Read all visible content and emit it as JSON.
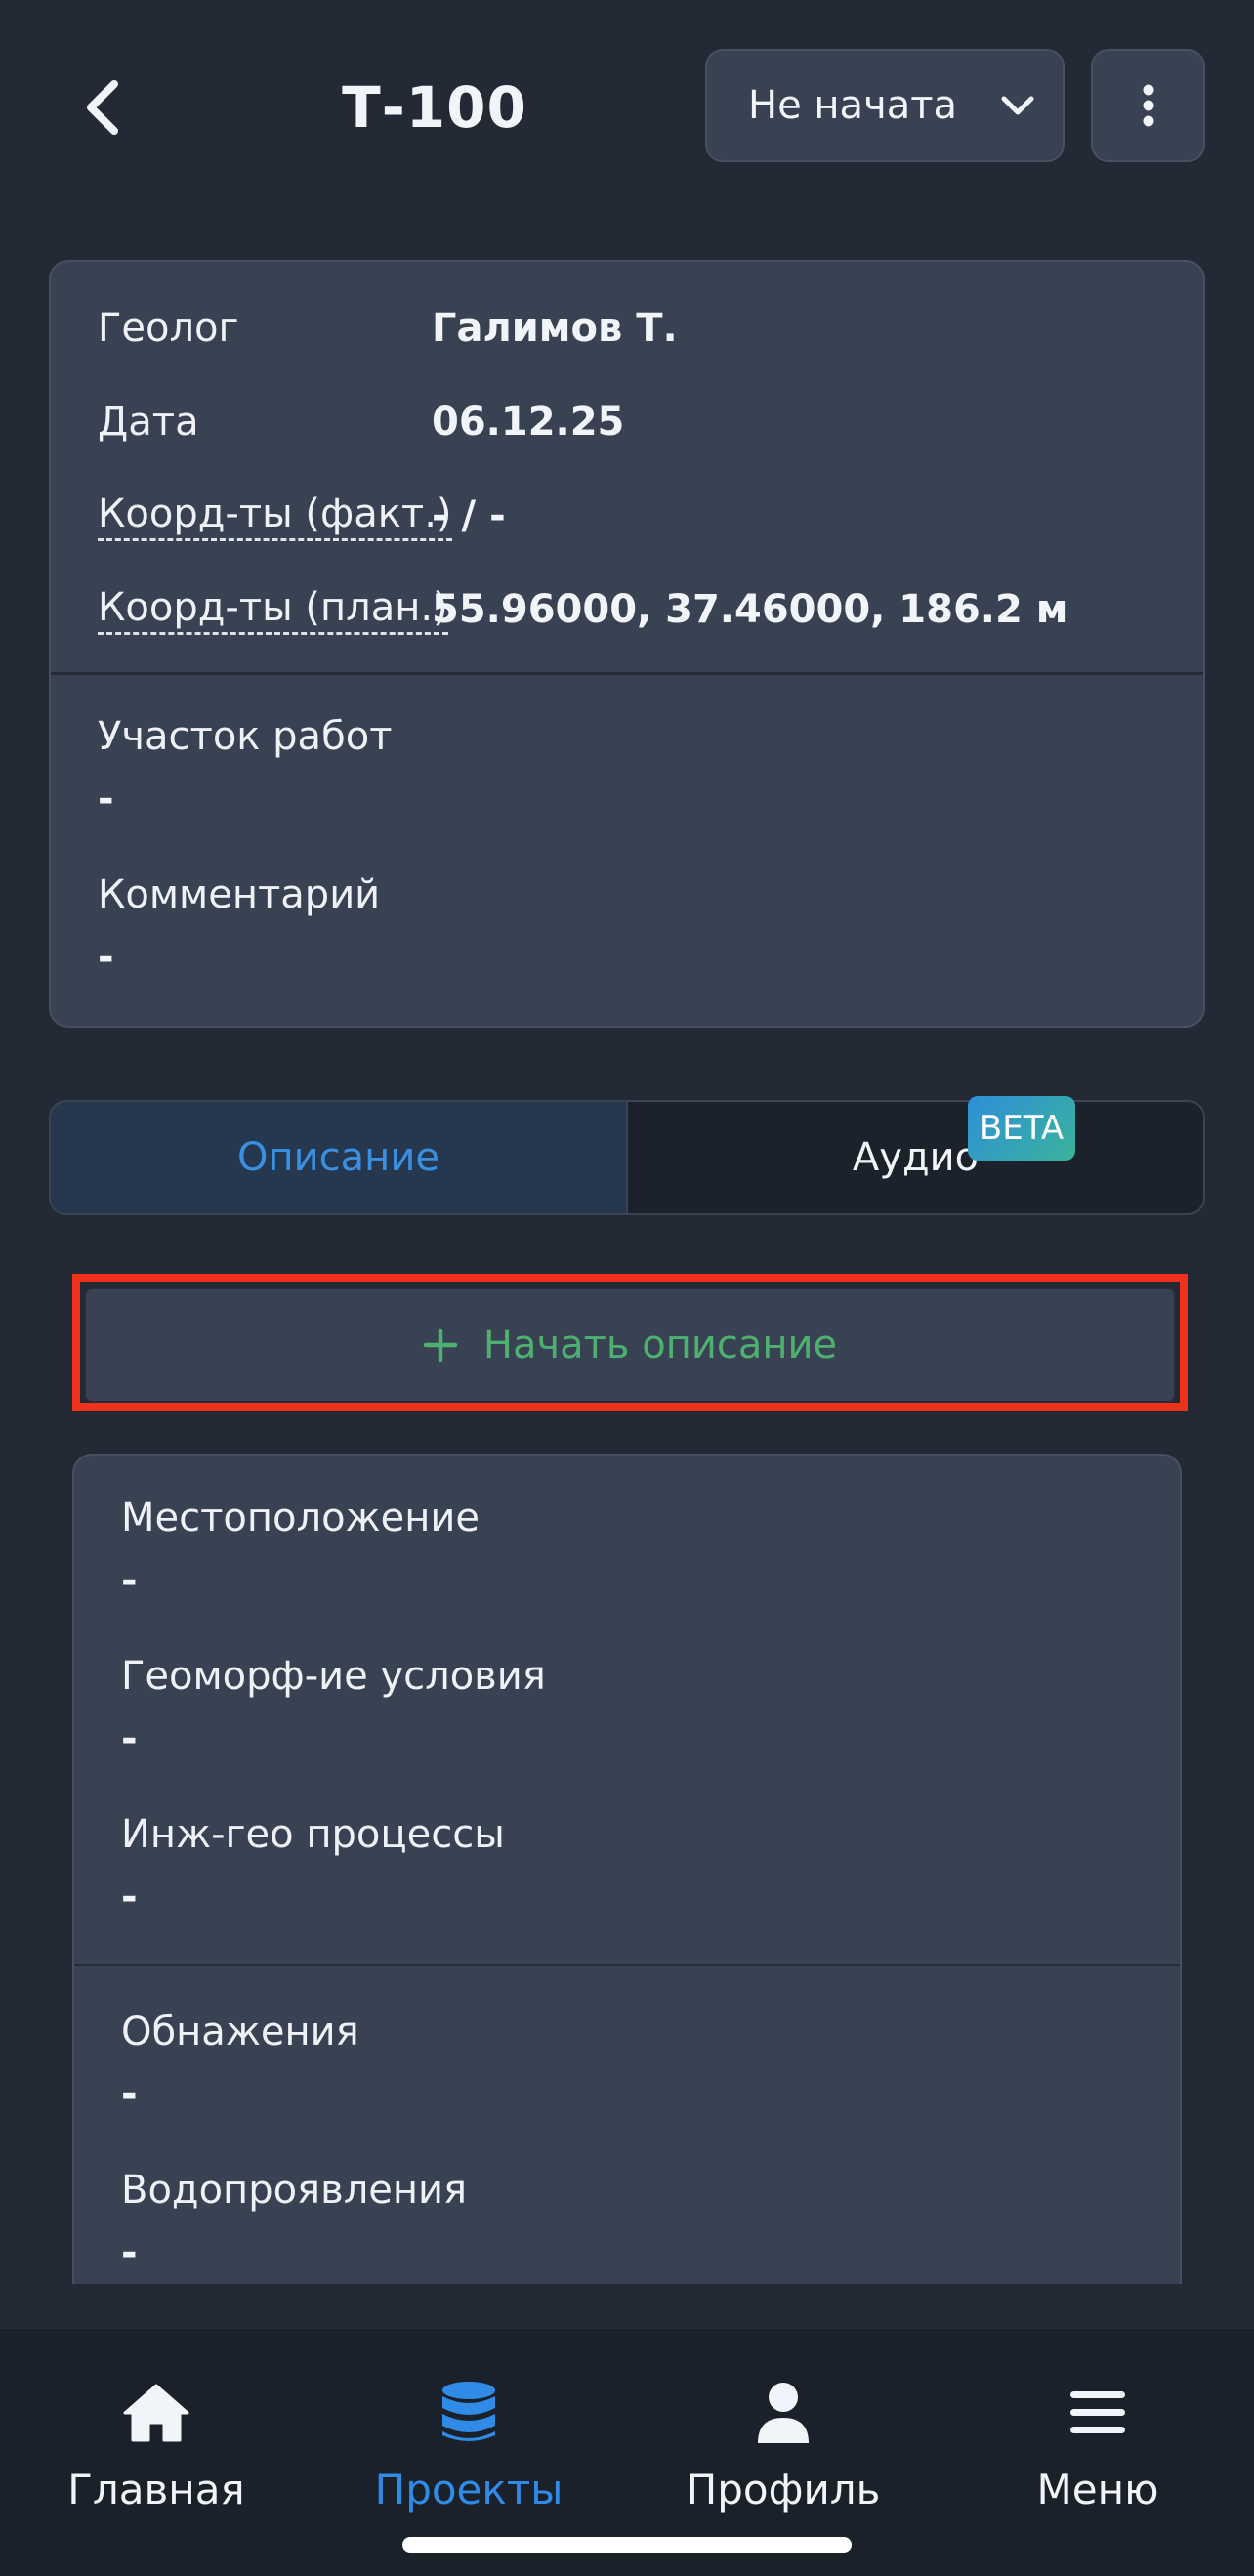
{
  "header": {
    "title": "Т-100",
    "status": "Не начата"
  },
  "info": {
    "rows": [
      {
        "label": "Геолог",
        "value": "Галимов Т."
      },
      {
        "label": "Дата",
        "value": "06.12.25"
      },
      {
        "label": "Коорд-ты (факт.)",
        "value": "- / -"
      },
      {
        "label": "Коорд-ты (план.)",
        "value": "55.96000, 37.46000, 186.2 м"
      }
    ],
    "work_area": {
      "label": "Участок работ",
      "value": "-"
    },
    "comment": {
      "label": "Комментарий",
      "value": "-"
    }
  },
  "tabs": {
    "description": "Описание",
    "audio": "Аудио",
    "badge": "BETA"
  },
  "start_button": "Начать описание",
  "description": {
    "fields": [
      {
        "label": "Местоположение",
        "value": "-"
      },
      {
        "label": "Геоморф-ие условия",
        "value": "-"
      },
      {
        "label": "Инж-гео процессы",
        "value": "-"
      },
      {
        "label": "Обнажения",
        "value": "-"
      },
      {
        "label": "Водопроявления",
        "value": "-"
      }
    ]
  },
  "nav": {
    "items": [
      {
        "label": "Главная",
        "icon": "home-icon"
      },
      {
        "label": "Проекты",
        "icon": "database-icon"
      },
      {
        "label": "Профиль",
        "icon": "user-icon"
      },
      {
        "label": "Меню",
        "icon": "menu-icon"
      }
    ]
  },
  "colors": {
    "background": "#232a36",
    "card": "#394252",
    "accent_blue": "#2f8be6",
    "accent_green": "#4db071",
    "highlight_red": "#f0321c"
  }
}
